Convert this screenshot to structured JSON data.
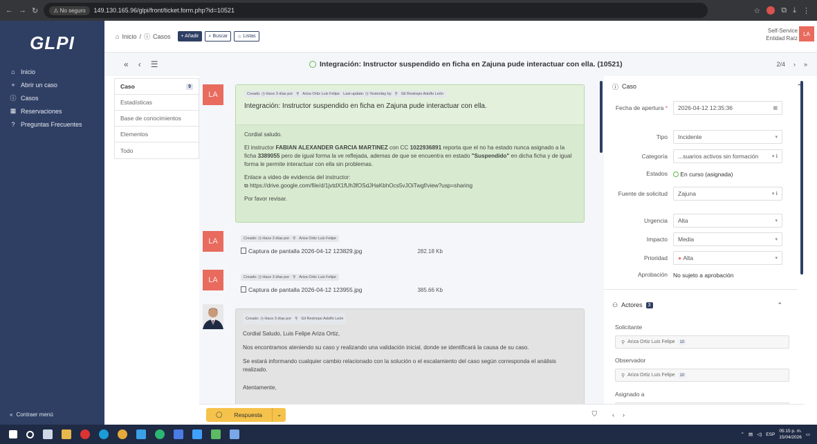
{
  "browser": {
    "not_secure": "No seguro",
    "url": "149.130.165.96/glpi/front/ticket.form.php?id=10521"
  },
  "sidebar": {
    "logo": "GLPI",
    "items": [
      {
        "icon": "home-icon",
        "label": "Inicio"
      },
      {
        "icon": "plus-icon",
        "label": "Abrir un caso"
      },
      {
        "icon": "alert-circle-icon",
        "label": "Casos"
      },
      {
        "icon": "calendar-icon",
        "label": "Reservaciones"
      },
      {
        "icon": "help-icon",
        "label": "Preguntas Frecuentes"
      }
    ],
    "collapse_label": "Contraer menú"
  },
  "topbar": {
    "breadcrumb_home": "Inicio",
    "breadcrumb_sep": "/",
    "breadcrumb_cases": "Casos",
    "add_label": "+ Añadir",
    "search_label": "Buscar",
    "lists_label": "Listas",
    "profile": "Self-Service",
    "entity": "Entidad Raíz",
    "user_initials": "LA"
  },
  "ticket": {
    "title": "Integración: Instructor suspendido en ficha en Zajuna pude interactuar con ella. (10521)",
    "position": "2/4"
  },
  "tabs": [
    {
      "label": "Caso",
      "badge": "9",
      "active": true
    },
    {
      "label": "Estadísticas"
    },
    {
      "label": "Base de conocimientos"
    },
    {
      "label": "Elementos"
    },
    {
      "label": "Todo"
    }
  ],
  "timeline": {
    "main": {
      "initials": "LA",
      "created": "Creado: ◷ Hace 3 días por",
      "author": "Ariza Ortiz Luis Felipe",
      "last_update": "Last update: ◷ Yesterday by",
      "updater": "Gil Restrepo Adolfo León",
      "title": "Integración: Instructor suspendido en ficha en Zajuna pude interactuar con ella.",
      "greeting": "Cordial saludo.",
      "p1_a": "El instructor ",
      "p1_name": "FABIAN ALEXANDER GARCIA MARTINEZ",
      "p1_b": " con CC ",
      "p1_cc": "1022936891",
      "p1_c": " reporta que el no ha estado nunca asignado a la ficha ",
      "p1_ficha": "3389055",
      "p1_d": " pero de igual forma la ve reflejada, ademas de que se encuentra en estado ",
      "p1_estado": "\"Suspendido\"",
      "p1_e": " en dicha ficha y de igual forma le permite interactuar con ella sin problemas.",
      "video_label": "Enlace a video de evidencia del instructor:",
      "video_link": "https://drive.google.com/file/d/1jvtdX1fUh3fOSdJHaKbhOcs5vJOiTwgf/view?usp=sharing",
      "closing": "Por favor revisar."
    },
    "docs": [
      {
        "initials": "LA",
        "created": "Creado: ◷ Hace 3 días por",
        "author": "Ariza Ortiz Luis Felipe",
        "file": "Captura de pantalla 2026-04-12 123829.jpg",
        "size": "282.18 Kb"
      },
      {
        "initials": "LA",
        "created": "Creado: ◷ Hace 3 días por",
        "author": "Ariza Ortiz Luis Felipe",
        "file": "Captura de pantalla 2026-04-12 123955.jpg",
        "size": "385.66 Kb"
      }
    ],
    "followup": {
      "created": "Creado: ◷ Hace 3 días por",
      "author": "Gil Restrepo Adolfo León",
      "p1": "Cordial Saludo, Luis Felipe Ariza Ortiz,",
      "p2": "Nos encontramos ateniendo su caso y realizando una validación inicial, donde se identificará la causa de su caso.",
      "p3": "Se estará informando cualquier cambio relacionado con la solución o el escalamiento del caso según corresponda el análisis realizado.",
      "p4": "Atentamente,"
    }
  },
  "bottom": {
    "answer_label": "Respuesta"
  },
  "details": {
    "section_title": "Caso",
    "opening_date_label": "Fecha de apertura",
    "opening_date": "2026-04-12 12:35:36",
    "type_label": "Tipo",
    "type": "Incidente",
    "category_label": "Categoría",
    "category": "...suarios activos sin formación",
    "status_label": "Estados",
    "status": "En curso (asignada)",
    "source_label": "Fuente de solicitud",
    "source": "Zajuna",
    "urgency_label": "Urgencia",
    "urgency": "Alta",
    "impact_label": "Impacto",
    "impact": "Media",
    "priority_label": "Prioridad",
    "priority": "Alta",
    "approval_label": "Aprobación",
    "approval": "No sujeto a aprobación"
  },
  "actors": {
    "title": "Actores",
    "count": "3",
    "requester_label": "Solicitante",
    "requester": "Ariza Ortiz Luis Felipe",
    "requester_count": "10",
    "observer_label": "Observador",
    "observer": "Ariza Ortiz Luis Felipe",
    "observer_count": "10",
    "assigned_label": "Asignado a"
  },
  "taskbar": {
    "lang": "ESP",
    "time": "05:15 p. m.",
    "date": "15/04/2026"
  },
  "colors": {
    "sidebar": "#2f3f64",
    "accent": "#f5c24b",
    "avatar": "#e86b5e",
    "main_bubble": "#d8ebd0"
  }
}
